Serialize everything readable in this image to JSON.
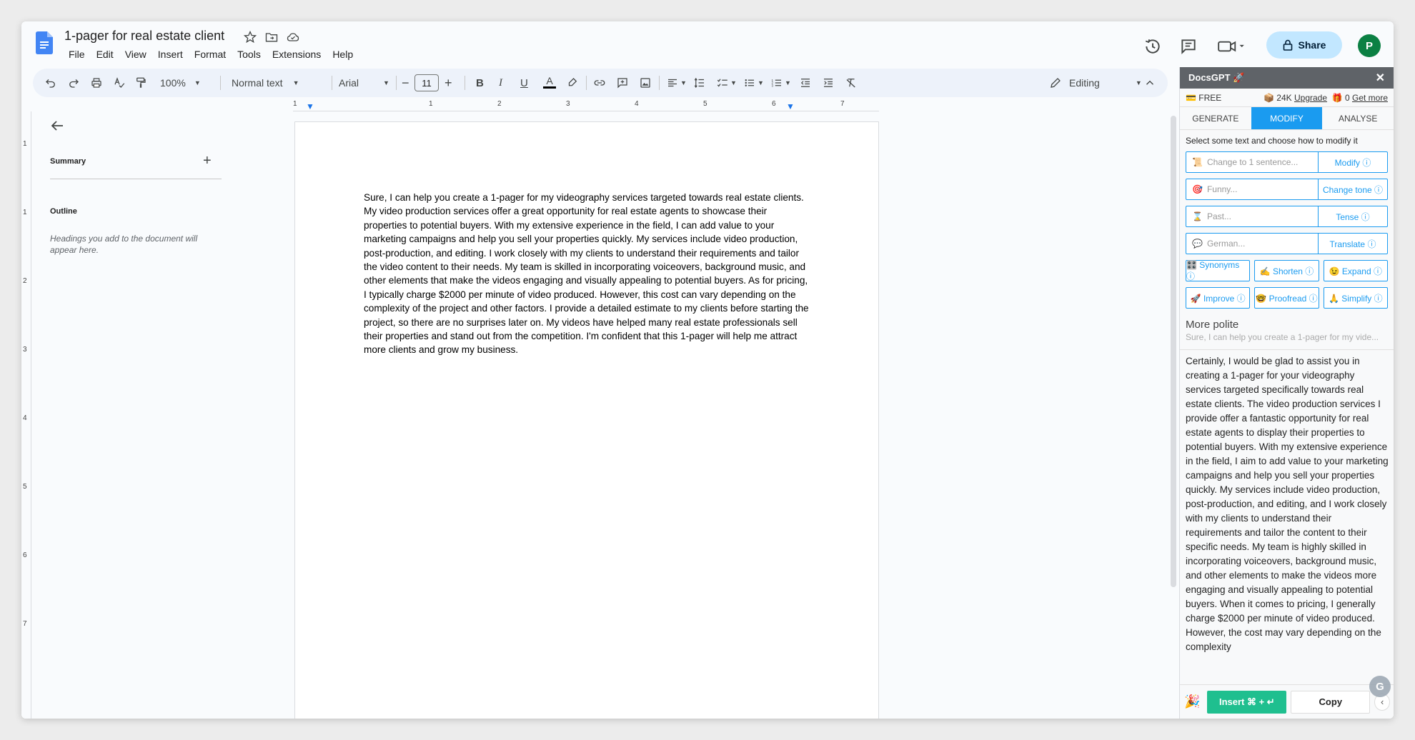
{
  "doc": {
    "title": "1-pager for real estate client",
    "avatar_initial": "P",
    "share_label": "Share",
    "body": "Sure, I can help you create a 1-pager for my videography services targeted towards real estate clients. My video production services offer a great opportunity for real estate agents to showcase their properties to potential buyers. With my extensive experience in the field, I can add value to your marketing campaigns and help you sell your properties quickly. My services include video production, post-production, and editing. I work closely with my clients to understand their requirements and tailor the video content to their needs. My team is skilled in incorporating voiceovers, background music, and other elements that make the videos engaging and visually appealing to potential buyers. As for pricing, I typically charge $2000 per minute of video produced. However, this cost can vary depending on the complexity of the project and other factors. I provide a detailed estimate to my clients before starting the project, so there are no surprises later on. My videos have helped many real estate professionals sell their properties and stand out from the competition. I'm confident that this 1-pager will help me attract more clients and grow my business."
  },
  "menu": [
    "File",
    "Edit",
    "View",
    "Insert",
    "Format",
    "Tools",
    "Extensions",
    "Help"
  ],
  "toolbar": {
    "zoom": "100%",
    "style": "Normal text",
    "font": "Arial",
    "font_size": "11",
    "mode": "Editing"
  },
  "outline": {
    "summary_label": "Summary",
    "outline_label": "Outline",
    "empty_hint": "Headings you add to the document will appear here."
  },
  "ruler": [
    "1",
    "1",
    "2",
    "3",
    "4",
    "5",
    "6",
    "7"
  ],
  "vruler": [
    "1",
    "1",
    "2",
    "3",
    "4",
    "5",
    "6",
    "7"
  ],
  "gpt": {
    "title": "DocsGPT 🚀",
    "plan": "💳 FREE",
    "credits": "📦 24K",
    "upgrade": "Upgrade",
    "bonus": "🎁 0",
    "get_more": "Get more",
    "tabs": [
      "GENERATE",
      "MODIFY",
      "ANALYSE"
    ],
    "hint": "Select some text and choose how to modify it",
    "rows": [
      {
        "emoji": "📜",
        "placeholder": "Change to 1 sentence...",
        "action": "Modify ⓘ"
      },
      {
        "emoji": "🎯",
        "placeholder": "Funny...",
        "action": "Change tone ⓘ"
      },
      {
        "emoji": "⌛",
        "placeholder": "Past...",
        "action": "Tense ⓘ"
      },
      {
        "emoji": "💬",
        "placeholder": "German...",
        "action": "Translate ⓘ"
      }
    ],
    "quick1": [
      "🎛️ Synonyms ⓘ",
      "✍️ Shorten ⓘ",
      "😉 Expand ⓘ"
    ],
    "quick2": [
      "🚀 Improve ⓘ",
      "🤓 Proofread ⓘ",
      "🙏 Simplify ⓘ"
    ],
    "result_title": "More polite",
    "result_source": "Sure, I can help you create a 1-pager for my vide...",
    "result_text": "Certainly, I would be glad to assist you in creating a 1-pager for your videography services targeted specifically towards real estate clients. The video production services I provide offer a fantastic opportunity for real estate agents to display their properties to potential buyers. With my extensive experience in the field, I aim to add value to your marketing campaigns and help you sell your properties quickly. My services include video production, post-production, and editing, and I work closely with my clients to understand their requirements and tailor the content to their specific needs. My team is highly skilled in incorporating voiceovers, background music, and other elements to make the videos more engaging and visually appealing to potential buyers. When it comes to pricing, I generally charge $2000 per minute of video produced. However, the cost may vary depending on the complexity",
    "insert_label": "Insert  ⌘ + ↵",
    "copy_label": "Copy",
    "party": "🎉"
  },
  "colors": {
    "accent": "#1a9bf0",
    "insert": "#1fbf8f",
    "share_bg": "#c2e7ff",
    "avatar": "#0b8043"
  }
}
